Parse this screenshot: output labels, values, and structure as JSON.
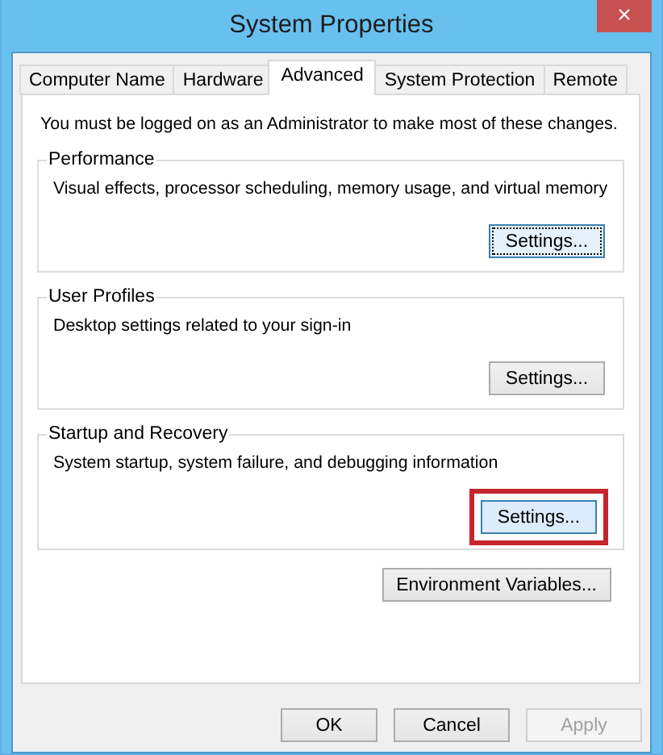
{
  "window": {
    "title": "System Properties",
    "close": "×"
  },
  "tabs": [
    {
      "label": "Computer Name",
      "selected": false
    },
    {
      "label": "Hardware",
      "selected": false
    },
    {
      "label": "Advanced",
      "selected": true
    },
    {
      "label": "System Protection",
      "selected": false
    },
    {
      "label": "Remote",
      "selected": false
    }
  ],
  "notice": "You must be logged on as an Administrator to make most of these changes.",
  "groups": [
    {
      "title": "Performance",
      "description": "Visual effects, processor scheduling, memory usage, and virtual memory",
      "button": {
        "label": "Settings...",
        "focused": true,
        "highlighted": false
      }
    },
    {
      "title": "User Profiles",
      "description": "Desktop settings related to your sign-in",
      "button": {
        "label": "Settings...",
        "focused": false,
        "highlighted": false
      }
    },
    {
      "title": "Startup and Recovery",
      "description": "System startup, system failure, and debugging information",
      "button": {
        "label": "Settings...",
        "focused": false,
        "highlighted": true
      }
    }
  ],
  "environment_button": {
    "label": "Environment Variables..."
  },
  "dialog_buttons": [
    {
      "label": "OK",
      "disabled": false
    },
    {
      "label": "Cancel",
      "disabled": false
    },
    {
      "label": "Apply",
      "disabled": true
    }
  ]
}
